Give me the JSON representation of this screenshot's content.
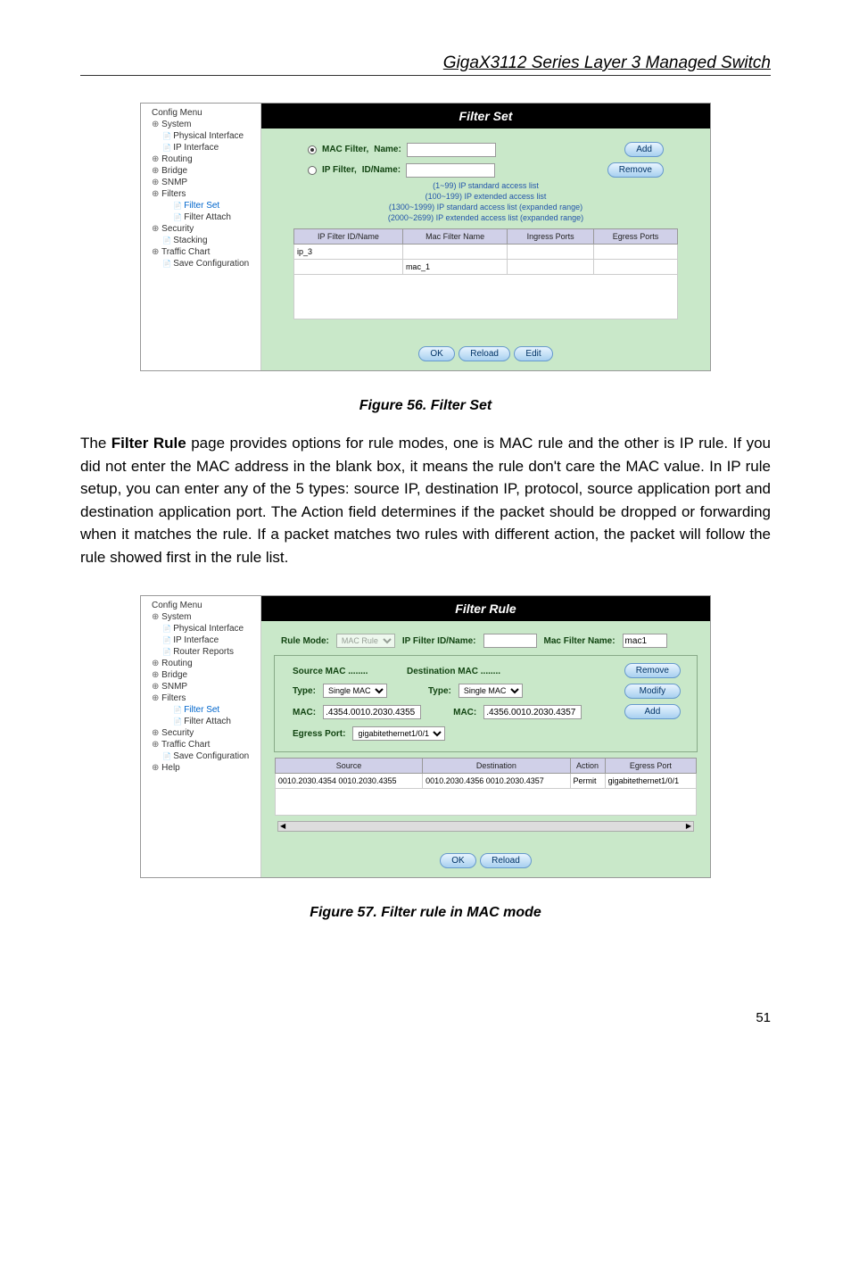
{
  "header": {
    "title": "GigaX3112 Series Layer 3 Managed Switch"
  },
  "paragraphs": {
    "p1": "The Filter Rule page provides options for rule modes, one is MAC rule and the other is IP rule. If you did not enter the MAC address in the blank box, it means the rule don't care the MAC value. In IP rule setup, you can enter any of the 5 types: source IP, destination IP, protocol, source application port and destination application port. The Action field determines if the packet should be dropped or forwarding when it matches the rule. If a packet matches two rules with different action, the packet will follow the rule showed first in the rule list.",
    "p1_prefix": "The ",
    "p1_bold": "Filter Rule",
    "p1_rest": " page provides options for rule modes, one is MAC rule and the other is IP rule. If you did not enter the MAC address in the blank box, it means the rule don't care the MAC value. In IP rule setup, you can enter any of the 5 types: source IP, destination IP, protocol, source application port  and destination application port. The Action field determines if the packet should be dropped or forwarding when it matches the rule. If a packet matches two rules with different action, the packet will follow the rule showed first in the rule list."
  },
  "captions": {
    "fig56": "Figure 56. Filter Set",
    "fig57": "Figure 57. Filter rule in MAC mode"
  },
  "tree1": {
    "root": "Config Menu",
    "system": "System",
    "physical": "Physical Interface",
    "ipinterface": "IP Interface",
    "routing": "Routing",
    "bridge": "Bridge",
    "snmp": "SNMP",
    "filters": "Filters",
    "filterset": "Filter Set",
    "filterattach": "Filter Attach",
    "security": "Security",
    "stacking": "Stacking",
    "traffic": "Traffic Chart",
    "saveconfig": "Save Configuration"
  },
  "tree2": {
    "root": "Config Menu",
    "system": "System",
    "physical": "Physical Interface",
    "ipinterface": "IP Interface",
    "router": "Router Reports",
    "routing": "Routing",
    "bridge": "Bridge",
    "snmp": "SNMP",
    "filters": "Filters",
    "filterset": "Filter Set",
    "filterattach": "Filter Attach",
    "security": "Security",
    "traffic": "Traffic Chart",
    "saveconfig": "Save Configuration",
    "help": "Help"
  },
  "filterset": {
    "title": "Filter Set",
    "mac_filter_label": "MAC Filter,",
    "name_label": "Name:",
    "ip_filter_label": "IP Filter,",
    "idname_label": "ID/Name:",
    "add_btn": "Add",
    "remove_btn": "Remove",
    "info": [
      "(1~99) IP standard access list",
      "(100~199) IP extended access list",
      "(1300~1999) IP standard access list (expanded range)",
      "(2000~2699) IP extended access list (expanded range)"
    ],
    "table_headers": [
      "IP Filter ID/Name",
      "Mac Filter Name",
      "Ingress Ports",
      "Egress Ports"
    ],
    "table_row": [
      "ip_3",
      "mac_1",
      "",
      ""
    ],
    "ok_btn": "OK",
    "reload_btn": "Reload",
    "edit_btn": "Edit"
  },
  "filterrule": {
    "title": "Filter Rule",
    "rule_mode_label": "Rule Mode:",
    "rule_mode_value": "MAC Rule",
    "ip_filter_idname_label": "IP Filter ID/Name:",
    "mac_filter_name_label": "Mac Filter Name:",
    "mac_filter_name_value": "mac1",
    "source_mac_label": "Source MAC ........",
    "dest_mac_label": "Destination MAC ........",
    "type_label": "Type:",
    "type_value": "Single MAC",
    "mac_label": "MAC:",
    "src_mac_value": ".4354.0010.2030.4355",
    "dst_mac_value": ".4356.0010.2030.4357",
    "egress_port_label": "Egress Port:",
    "egress_port_value": "gigabitethernet1/0/1",
    "remove_btn": "Remove",
    "modify_btn": "Modify",
    "add_btn": "Add",
    "table_headers": [
      "Source",
      "Destination",
      "Action",
      "Egress Port"
    ],
    "table_row": [
      "0010.2030.4354 0010.2030.4355",
      "0010.2030.4356 0010.2030.4357",
      "Permit",
      "gigabitethernet1/0/1"
    ],
    "ok_btn": "OK",
    "reload_btn": "Reload"
  },
  "footer": {
    "page": "51"
  }
}
